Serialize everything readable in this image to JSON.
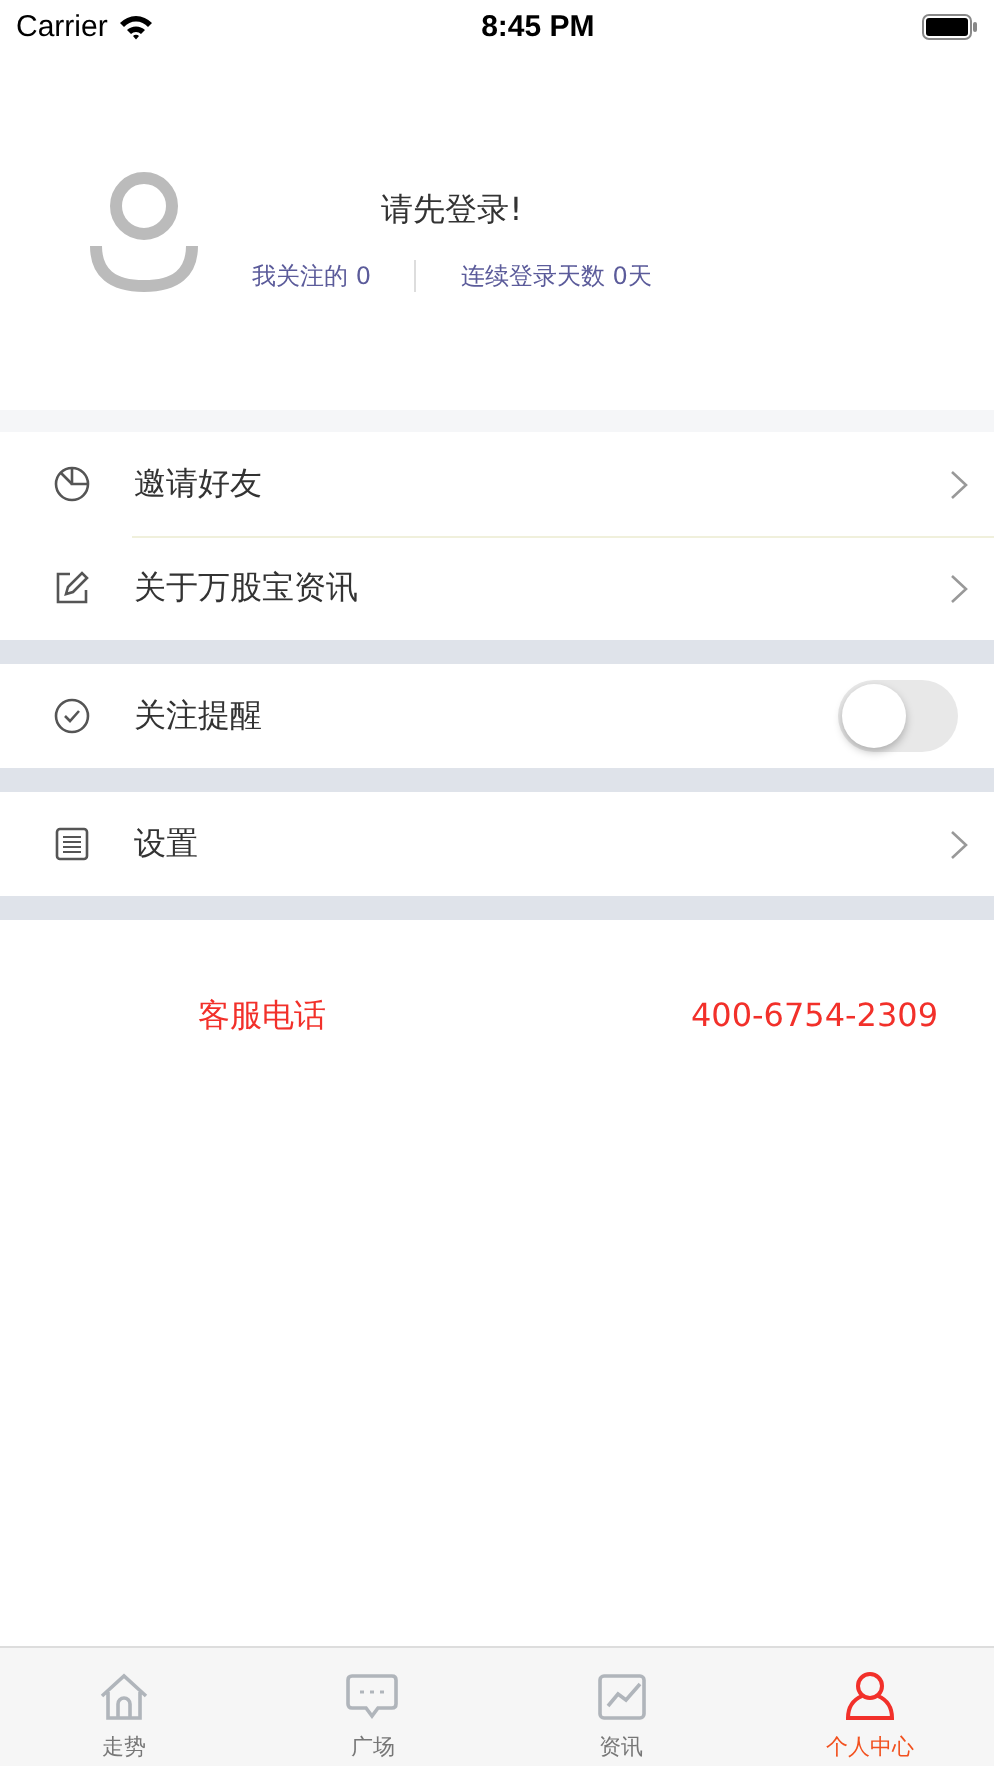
{
  "status_bar": {
    "carrier": "Carrier",
    "time": "8:45 PM"
  },
  "profile": {
    "prompt": "请先登录!",
    "stats": [
      "我关注的 0",
      "连续登录天数 0天"
    ]
  },
  "sections": [
    {
      "items": [
        {
          "kind": "link",
          "label": "邀请好友"
        },
        {
          "kind": "link",
          "label": "关于万股宝资讯"
        }
      ]
    },
    {
      "items": [
        {
          "kind": "toggle",
          "label": "关注提醒",
          "on": false
        }
      ]
    },
    {
      "items": [
        {
          "kind": "link",
          "label": "设置"
        }
      ]
    }
  ],
  "hotline": {
    "label": "客服电话",
    "number": "400-6754-2309"
  },
  "tab_bar": [
    {
      "label": "走势",
      "selected": false
    },
    {
      "label": "广场",
      "selected": false
    },
    {
      "label": "资讯",
      "selected": false
    },
    {
      "label": "个人中心",
      "selected": true
    }
  ]
}
